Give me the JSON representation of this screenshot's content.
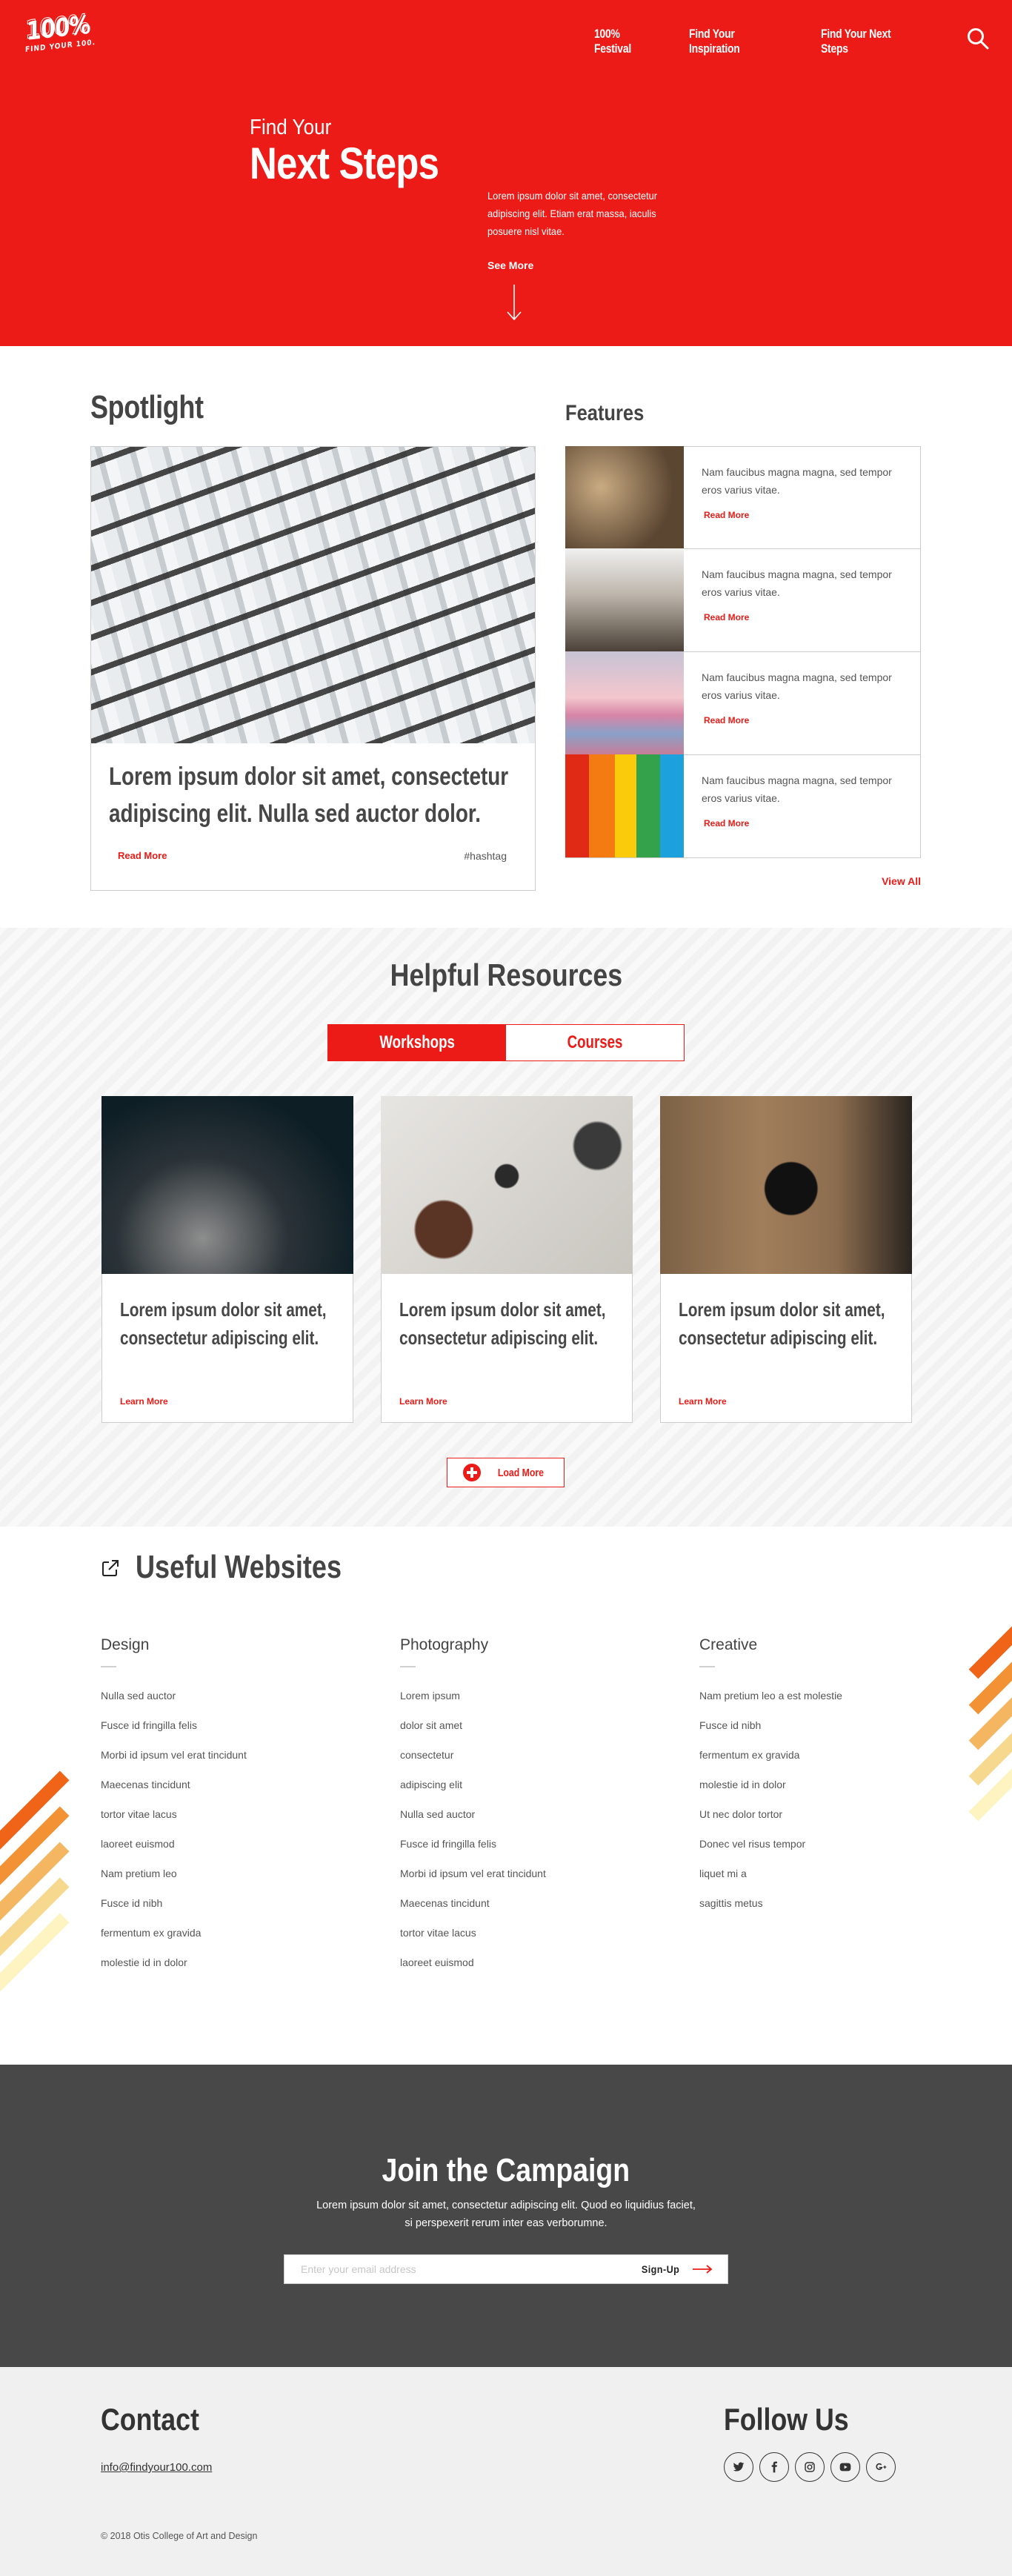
{
  "header": {
    "logo_big": "100%",
    "logo_small": "FIND YOUR 100.",
    "nav": [
      {
        "label": "100% Festival"
      },
      {
        "label": "Find Your Inspiration"
      },
      {
        "label": "Find Your Next Steps"
      }
    ],
    "search_icon": "search-icon"
  },
  "hero": {
    "pre_title": "Find Your",
    "title": "Next Steps",
    "body": "Lorem ipsum dolor sit amet, consectetur adipiscing elit. Etiam erat massa, iaculis posuere nisl vitae.",
    "see_more": "See More",
    "arrow_icon": "arrow-down-icon"
  },
  "spotlight": {
    "heading": "Spotlight",
    "title": "Lorem ipsum dolor sit amet, consectetur adipiscing elit. Nulla sed auctor dolor.",
    "title_line1": "Lorem ipsum dolor sit amet, consectetur",
    "title_line2": "adipiscing elit. Nulla sed auctor dolor.",
    "read_more": "Read More",
    "hashtag": "#hashtag"
  },
  "features": {
    "heading": "Features",
    "items": [
      {
        "text": "Nam faucibus magna magna, sed tempor eros varius vitae.",
        "link": "Read More"
      },
      {
        "text": "Nam faucibus magna magna, sed tempor eros varius vitae.",
        "link": "Read More"
      },
      {
        "text": "Nam faucibus magna magna, sed tempor eros varius vitae.",
        "link": "Read More"
      },
      {
        "text": "Nam faucibus magna magna, sed tempor eros varius vitae.",
        "link": "Read More"
      }
    ],
    "view_all": "View All"
  },
  "resources": {
    "heading": "Helpful Resources",
    "tabs": [
      {
        "label": "Workshops",
        "active": true
      },
      {
        "label": "Courses",
        "active": false
      }
    ],
    "cards": [
      {
        "line1": "Lorem ipsum dolor sit amet,",
        "line2": "consectetur adipiscing elit.",
        "link": "Learn More"
      },
      {
        "line1": "Lorem ipsum dolor sit amet,",
        "line2": "consectetur adipiscing elit.",
        "link": "Learn More"
      },
      {
        "line1": "Lorem ipsum dolor sit amet,",
        "line2": "consectetur adipiscing elit.",
        "link": "Learn More"
      }
    ],
    "load_more": "Load More"
  },
  "websites": {
    "heading": "Useful Websites",
    "columns": [
      {
        "title": "Design",
        "links": [
          "Nulla sed auctor",
          "Fusce id fringilla felis",
          "Morbi id ipsum vel erat tincidunt",
          "Maecenas tincidunt",
          "tortor vitae lacus",
          "laoreet euismod",
          "Nam pretium leo",
          "Fusce id nibh",
          "fermentum ex gravida",
          "molestie id in dolor"
        ]
      },
      {
        "title": "Photography",
        "links": [
          "Lorem ipsum",
          "dolor sit amet",
          "consectetur",
          "adipiscing elit",
          "Nulla sed auctor",
          "Fusce id fringilla felis",
          "Morbi id ipsum vel erat tincidunt",
          "Maecenas tincidunt",
          "tortor vitae lacus",
          "laoreet euismod"
        ]
      },
      {
        "title": "Creative",
        "links": [
          "Nam pretium leo a est molestie",
          "Fusce id nibh",
          "fermentum ex gravida",
          "molestie id in dolor",
          "Ut nec dolor tortor",
          "Donec vel risus tempor",
          "liquet mi a",
          "sagittis metus"
        ]
      }
    ],
    "stripe_colors": [
      "#f06418",
      "#f39235",
      "#f4b661",
      "#f6d88f",
      "#fdf4c2"
    ]
  },
  "campaign": {
    "heading": "Join the Campaign",
    "body": "Lorem ipsum dolor sit amet, consectetur adipiscing elit. Quod eo liquidius faciet, si perspexerit rerum inter eas verborumne.",
    "email_placeholder": "Enter your email address",
    "email_value": "",
    "signup": "Sign-Up"
  },
  "footer": {
    "contact_heading": "Contact",
    "email": "info@findyour100.com",
    "copyright": "© 2018 Otis College of Art and Design",
    "follow_heading": "Follow Us",
    "socials": [
      "twitter-icon",
      "facebook-icon",
      "instagram-icon",
      "youtube-icon",
      "google-plus-icon"
    ]
  },
  "colors": {
    "brand_red": "#ed1b17",
    "dark_gray": "#484848",
    "footer_bg": "#f0f0f0"
  }
}
